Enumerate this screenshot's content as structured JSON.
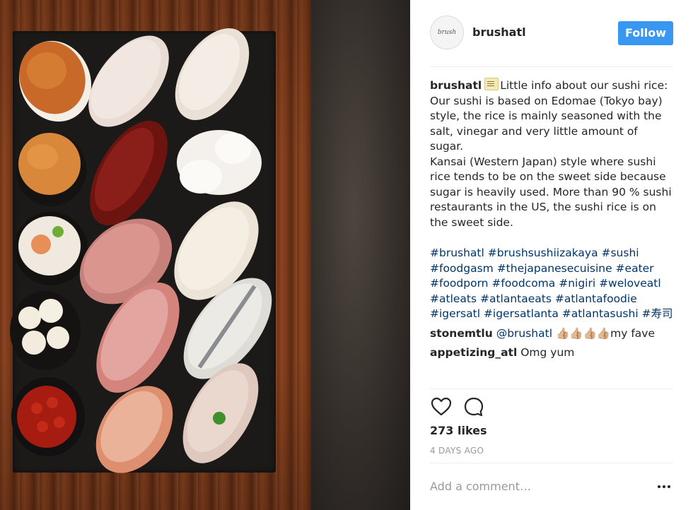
{
  "post": {
    "image_alt": "Assorted nigiri sushi on a dark slate board",
    "author": "brushatl",
    "avatar_text": "brush",
    "follow_label": "Follow"
  },
  "caption": {
    "user": "brushatl",
    "lines": [
      "Little info about our sushi rice:",
      "Our sushi is based on Edomae (Tokyo bay) style, the rice is mainly seasoned with the salt, vinegar and very little amount of sugar.",
      "Kansai (Western Japan) style where sushi rice tends to be on the sweet side because sugar is heavily used. More than 90 % sushi restaurants in the US, the sushi rice is on the sweet side."
    ],
    "hashtags": "#brushatl #brushsushiizakaya #sushi #foodgasm #thejapanesecuisine #eater #foodporn #foodcoma #nigiri #weloveatl #atleats #atlantaeats #atlantafoodie #igersatl #igersatlanta #atlantasushi #寿司"
  },
  "comments": [
    {
      "user": "stonemtlu",
      "mention": "@brushatl",
      "text": "👍🏼👍🏼👍🏼👍🏼my fave"
    },
    {
      "user": "appetizing_atl",
      "mention": "",
      "text": "Omg yum"
    }
  ],
  "actions": {
    "like_icon": "heart-icon",
    "comment_icon": "comment-bubble-icon"
  },
  "likes": "273 likes",
  "timestamp": "4 DAYS AGO",
  "add_comment_placeholder": "Add a comment…",
  "more_icon": "more-options-icon",
  "colors": {
    "follow_button": "#3897f0",
    "hashtag": "#003569",
    "muted": "#999999"
  }
}
